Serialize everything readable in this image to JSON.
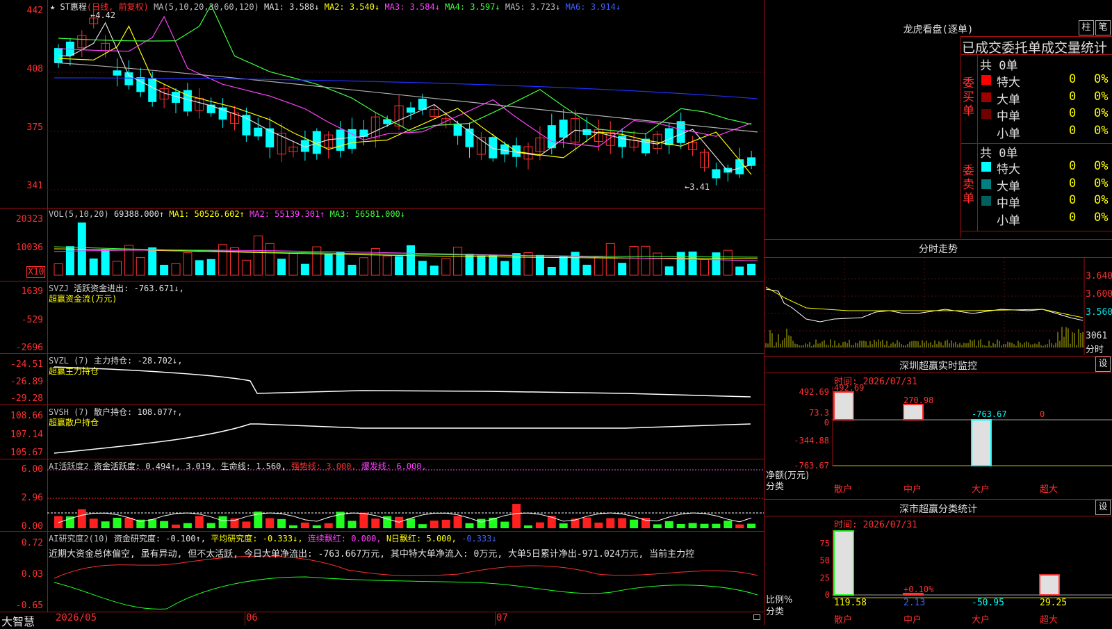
{
  "chart_main": {
    "stock_name": "ST惠程",
    "period": "(日线, 前复权)",
    "ma_param": "MA(5,10,20,30,60,120)",
    "ma_values": [
      {
        "label": "MA1:",
        "value": "3.588↓",
        "color": "#e0e0e0"
      },
      {
        "label": "MA2:",
        "value": "3.540↓",
        "color": "#ffff00"
      },
      {
        "label": "MA3:",
        "value": "3.584↓",
        "color": "#ff40ff"
      },
      {
        "label": "MA4:",
        "value": "3.597↓",
        "color": "#40ff40"
      },
      {
        "label": "MA5:",
        "value": "3.723↓",
        "color": "#c0c0c0"
      },
      {
        "label": "MA6:",
        "value": "3.914↓",
        "color": "#4060ff"
      }
    ],
    "high_marker": "4.42",
    "low_marker": "←3.41",
    "yticks": [
      "442",
      "408",
      "375",
      "341"
    ]
  },
  "chart_vol": {
    "title": "VOL(5,10,20)",
    "value": "69388.000↑",
    "ma1": "MA1: 50526.602↑",
    "ma2": "MA2: 55139.301↑",
    "ma3": "MA3: 56581.000↓",
    "yticks": [
      "20323",
      "10036"
    ],
    "unit": "X10"
  },
  "chart_svzj": {
    "name": "SVZJ",
    "desc": "活跃资金进出: -763.671↓,",
    "sub": "超赢资金流(万元)",
    "yticks": [
      "1639",
      "-529",
      "-2696"
    ]
  },
  "chart_svzl": {
    "name": "SVZL (7)",
    "desc": "主力持仓: -28.702↓,",
    "sub": "超赢主力持仓",
    "yticks": [
      "-24.51",
      "-26.89",
      "-29.28"
    ]
  },
  "chart_svsh": {
    "name": "SVSH (7)",
    "desc": "散户持仓: 108.077↑,",
    "sub": "超赢散户持仓",
    "yticks": [
      "108.66",
      "107.14",
      "105.67"
    ]
  },
  "chart_ai1": {
    "name": "AI活跃度2",
    "a": "资金活跃度: 0.494↑,",
    "b": "3.019,",
    "c": "生命线: 1.560,",
    "d": "强势线: 3.000,",
    "e": "爆发线: 6.000,",
    "yticks": [
      "6.00",
      "2.96",
      "0.00"
    ]
  },
  "chart_ai2": {
    "name": "AI研究度2(10)",
    "a": "资金研究度: -0.100↑,",
    "b": "平均研究度: -0.333↓,",
    "c": "连续飘红: 0.000,",
    "d": "N日飘红: 5.000,",
    "e": "-0.333↓",
    "comment": "近期大资金总体偏空, 虽有异动, 但不太活跃, 今日大单净流出: -763.667万元, 其中特大单净流入: 0万元, 大单5日累计净出-971.024万元, 当前主力控",
    "yticks": [
      "0.72",
      "0.03",
      "-0.65"
    ]
  },
  "xaxis": {
    "app": "大智慧",
    "labels": [
      "2026/05",
      "06",
      "07"
    ]
  },
  "dragon": {
    "title": "龙虎看盘(逐单)",
    "btn1": "柱",
    "btn2": "笔",
    "header": "已成交委托单成交量统计",
    "buy_side": "委买单",
    "sell_side": "委卖单",
    "buy_total": "共 0单",
    "sell_total": "共 0单",
    "buy_rows": [
      {
        "label": "特大",
        "count": "0",
        "pct": "0%",
        "color": "#ff0000"
      },
      {
        "label": "大单",
        "count": "0",
        "pct": "0%",
        "color": "#a00000"
      },
      {
        "label": "中单",
        "count": "0",
        "pct": "0%",
        "color": "#700000"
      },
      {
        "label": "小单",
        "count": "0",
        "pct": "0%",
        "color": ""
      }
    ],
    "sell_rows": [
      {
        "label": "特大",
        "count": "0",
        "pct": "0%",
        "color": "#00ffff"
      },
      {
        "label": "大单",
        "count": "0",
        "pct": "0%",
        "color": "#008080"
      },
      {
        "label": "中单",
        "count": "0",
        "pct": "0%",
        "color": "#006060"
      },
      {
        "label": "小单",
        "count": "0",
        "pct": "0%",
        "color": ""
      }
    ]
  },
  "intraday": {
    "title": "分时走势",
    "yticks": [
      "3.640",
      "3.600",
      "3.560"
    ],
    "vol": "3061",
    "vol_label": "分时"
  },
  "monitor": {
    "title": "深圳超赢实时监控",
    "btn": "设",
    "time": "时间: 2026/07/31",
    "yticks": [
      "492.69",
      "73.3",
      "0",
      "-344.88",
      "-763.67"
    ],
    "values": [
      {
        "cat": "散户",
        "value": 492.69,
        "label": "492.69"
      },
      {
        "cat": "中户",
        "value": 270.98,
        "label": "270.98"
      },
      {
        "cat": "大户",
        "value": -763.67,
        "label": "-763.67"
      },
      {
        "cat": "超大",
        "value": 0,
        "label": "0"
      }
    ],
    "ylabel": "净额(万元)",
    "xlabel": "分类"
  },
  "stats": {
    "title": "深市超赢分类统计",
    "btn": "设",
    "time": "时间: 2026/07/31",
    "yticks": [
      "75",
      "50",
      "25",
      "0"
    ],
    "values": [
      {
        "cat": "散户",
        "value": 119.58,
        "label": "119.58",
        "color": "#ffff00"
      },
      {
        "cat": "中户",
        "value": 2.13,
        "label": "2.13",
        "color": "#4060ff"
      },
      {
        "cat": "大户",
        "value": -50.95,
        "label": "-50.95",
        "color": "#00ffff"
      },
      {
        "cat": "超大",
        "value": 29.25,
        "label": "29.25",
        "color": "#ffff00"
      }
    ],
    "note": "+0.10%",
    "ylabel": "比例%",
    "xlabel": "分类"
  }
}
